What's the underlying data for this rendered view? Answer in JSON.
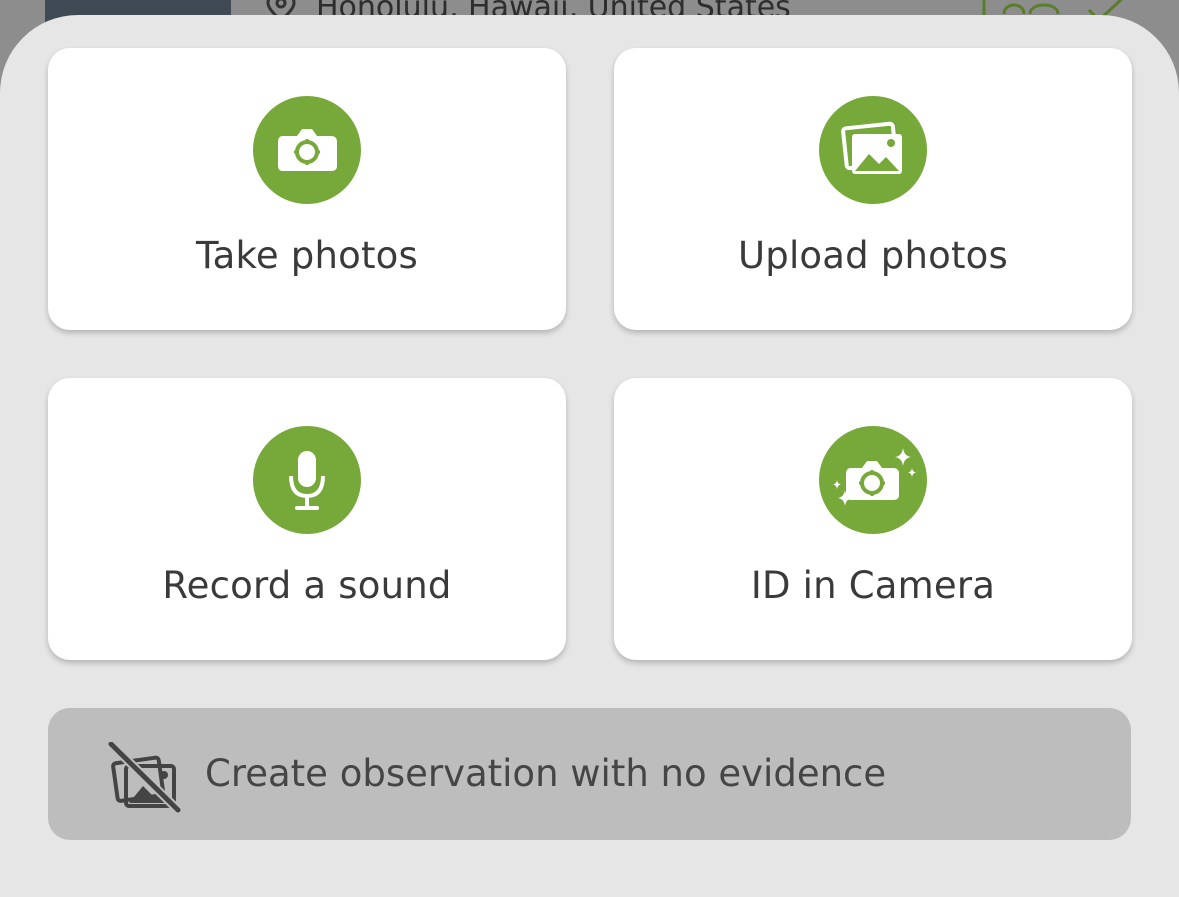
{
  "background": {
    "location": "Honolulu, Hawaii, United States"
  },
  "options": {
    "take_photos": {
      "label": "Take photos",
      "icon": "camera-icon"
    },
    "upload_photos": {
      "label": "Upload photos",
      "icon": "photo-gallery-icon"
    },
    "record_sound": {
      "label": "Record a sound",
      "icon": "microphone-icon"
    },
    "id_camera": {
      "label": "ID in Camera",
      "icon": "sparkle-camera-icon"
    }
  },
  "no_evidence": {
    "label": "Create observation with no evidence",
    "icon": "no-photo-icon"
  },
  "colors": {
    "accent": "#77a83a",
    "sheet": "#e6e6e6",
    "card": "#ffffff",
    "secondary_button": "#bdbdbd",
    "text": "#3a3a3a"
  }
}
